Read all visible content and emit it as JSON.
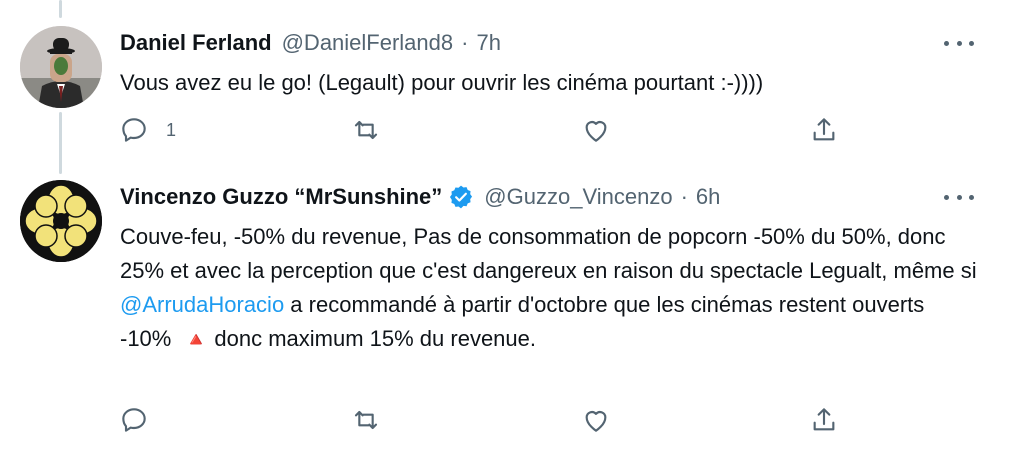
{
  "tweets": [
    {
      "name": "Daniel Ferland",
      "handle": "@DanielFerland8",
      "separator": "·",
      "time": "7h",
      "text": "Vous avez eu le go! (Legault) pour ouvrir les cinéma pourtant :-))))",
      "reply_count": "1",
      "avatar_icon": "profile-photo-bowler-hat-man"
    },
    {
      "name": "Vincenzo Guzzo “MrSunshine”",
      "handle": "@Guzzo_Vincenzo",
      "separator": "·",
      "time": "6h",
      "verified": true,
      "text_before": "Couve-feu, -50% du revenue, Pas de consommation de popcorn -50% du 50%, donc 25% et avec la perception que c'est dangereux en raison du spectacle Legualt, même si ",
      "mention": "@ArrudaHoracio",
      "text_middle": " a recommandé à partir d'octobre que les cinémas restent ouverts -10% ",
      "emoji": "🔺",
      "text_after": "donc maximum 15% du revenue.",
      "avatar_icon": "yellow-flower-logo"
    }
  ],
  "colors": {
    "text": "#0f1419",
    "secondary": "#536471",
    "link": "#1d9bf0",
    "thread_line": "#cfd9de",
    "triangle": "#e0565b"
  },
  "icons": [
    "reply-icon",
    "retweet-icon",
    "like-icon",
    "share-icon",
    "more-icon",
    "verified-badge-icon"
  ]
}
